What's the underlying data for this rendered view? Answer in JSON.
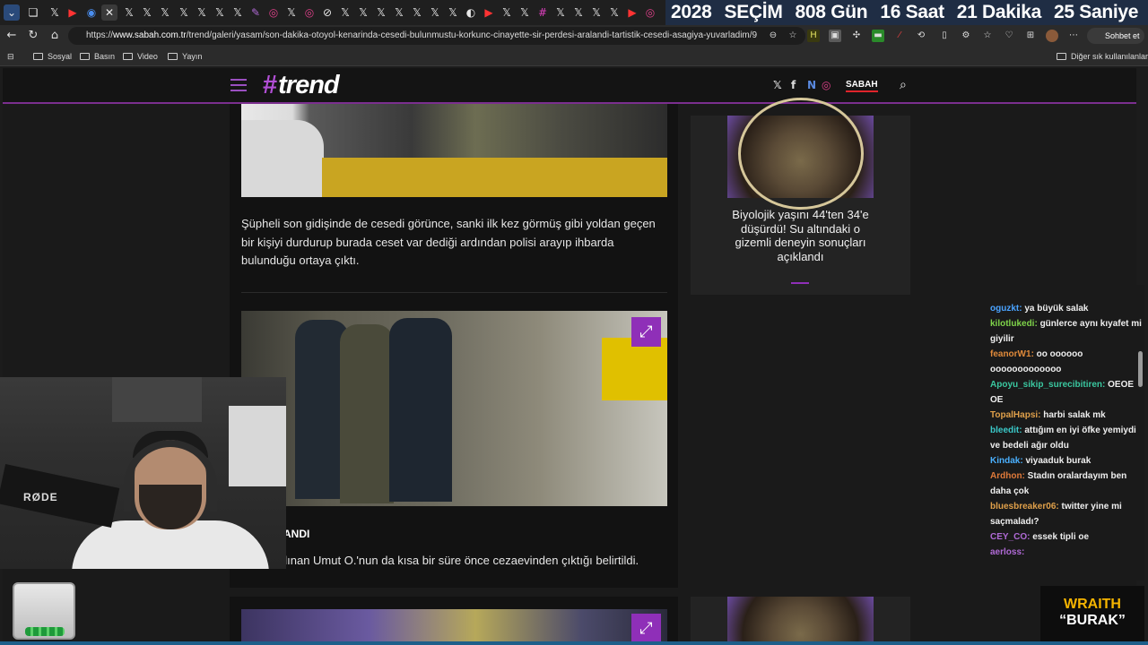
{
  "browser": {
    "countdown": {
      "year": "2028",
      "label": "SEÇİM",
      "days": "808 Gün",
      "hours": "16 Saat",
      "minutes": "21 Dakika",
      "seconds": "25 Saniye"
    },
    "url_prefix": "https://",
    "url_host": "www.sabah.com.tr",
    "url_path": "/trend/galeri/yasam/son-dakika-otoyol-kenarinda-cesedi-bulunmustu-korkunc-cinayette-sir-perdesi-aralandi-tartistik-cesedi-asagiya-yuvarladim/9",
    "chat_button": "Sohbet et",
    "bookmarks": [
      "Sosyal",
      "Basın",
      "Video",
      "Yayın"
    ],
    "other_bookmarks": "Diğer sık kullanılanlar"
  },
  "site": {
    "logo": "trend",
    "sabah_label": "SABAH"
  },
  "article": {
    "paragraph1": "Şüpheli son gidişinde de cesedi görünce, sanki ilk kez görmüş gibi yoldan geçen bir kişiyi durdurup burada ceset var dediği ardından polisi arayıp ihbarda bulunduğu ortaya çıktı.",
    "subhead_partial": "ANDI",
    "paragraph2_partial": "alınan Umut O.'nun da kısa bir süre önce cezaevinden çıktığı belirtildi."
  },
  "sidebar": {
    "card_title": "Biyolojik yaşını 44'ten 34'e düşürdü! Su altındaki o gizemli deneyin sonuçları açıklandı"
  },
  "chat": {
    "messages": [
      {
        "user": "oguzkt",
        "text": "ya büyük salak",
        "color": "#4aa3ff"
      },
      {
        "user": "kilotlukedi",
        "text": "günlerce aynı kıyafet mi giyilir",
        "color": "#7fd44a"
      },
      {
        "user": "feanorW1",
        "text": "oo oooooo ooooooooooooo",
        "color": "#e08a3a"
      },
      {
        "user": "Apoyu_sikip_surecibitiren",
        "text": "OEOE OE",
        "color": "#3ac8a0"
      },
      {
        "user": "TopalHapsi",
        "text": "harbi salak mk",
        "color": "#e0a04a"
      },
      {
        "user": "bleedit",
        "text": "attığım en iyi öfke yemiydi ve bedeli ağır oldu",
        "color": "#3ac8c8"
      },
      {
        "user": "Kindak",
        "text": "viyaaduk burak",
        "color": "#4ab0ff"
      },
      {
        "user": "Ardhon",
        "text": "Stadın oralardayım ben daha çok",
        "color": "#e07a3a"
      },
      {
        "user": "bluesbreaker06",
        "text": "twitter yine mi saçmaladı?",
        "color": "#e0a04a"
      },
      {
        "user": "CEY_CO",
        "text": "essek tipli oe",
        "color": "#b06ad6"
      },
      {
        "user": "aerloss",
        "text": "",
        "color": "#b06ad6"
      }
    ]
  },
  "overlay": {
    "mic_brand": "RØDE",
    "wraith_line1": "WRAITH",
    "wraith_line2": "“BURAK”"
  },
  "colors": {
    "accent": "#8f2fb8",
    "countdown_bg": "#1f2d44"
  }
}
